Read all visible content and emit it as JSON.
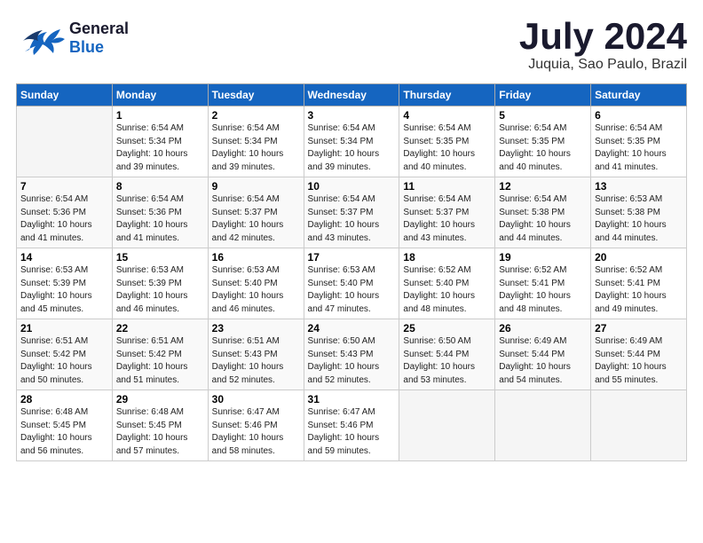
{
  "header": {
    "logo": {
      "line1": "General",
      "line2": "Blue"
    },
    "title": "July 2024",
    "location": "Juquia, Sao Paulo, Brazil"
  },
  "weekdays": [
    "Sunday",
    "Monday",
    "Tuesday",
    "Wednesday",
    "Thursday",
    "Friday",
    "Saturday"
  ],
  "weeks": [
    [
      {
        "day": "",
        "info": ""
      },
      {
        "day": "1",
        "info": "Sunrise: 6:54 AM\nSunset: 5:34 PM\nDaylight: 10 hours\nand 39 minutes."
      },
      {
        "day": "2",
        "info": "Sunrise: 6:54 AM\nSunset: 5:34 PM\nDaylight: 10 hours\nand 39 minutes."
      },
      {
        "day": "3",
        "info": "Sunrise: 6:54 AM\nSunset: 5:34 PM\nDaylight: 10 hours\nand 39 minutes."
      },
      {
        "day": "4",
        "info": "Sunrise: 6:54 AM\nSunset: 5:35 PM\nDaylight: 10 hours\nand 40 minutes."
      },
      {
        "day": "5",
        "info": "Sunrise: 6:54 AM\nSunset: 5:35 PM\nDaylight: 10 hours\nand 40 minutes."
      },
      {
        "day": "6",
        "info": "Sunrise: 6:54 AM\nSunset: 5:35 PM\nDaylight: 10 hours\nand 41 minutes."
      }
    ],
    [
      {
        "day": "7",
        "info": "Sunrise: 6:54 AM\nSunset: 5:36 PM\nDaylight: 10 hours\nand 41 minutes."
      },
      {
        "day": "8",
        "info": "Sunrise: 6:54 AM\nSunset: 5:36 PM\nDaylight: 10 hours\nand 41 minutes."
      },
      {
        "day": "9",
        "info": "Sunrise: 6:54 AM\nSunset: 5:37 PM\nDaylight: 10 hours\nand 42 minutes."
      },
      {
        "day": "10",
        "info": "Sunrise: 6:54 AM\nSunset: 5:37 PM\nDaylight: 10 hours\nand 43 minutes."
      },
      {
        "day": "11",
        "info": "Sunrise: 6:54 AM\nSunset: 5:37 PM\nDaylight: 10 hours\nand 43 minutes."
      },
      {
        "day": "12",
        "info": "Sunrise: 6:54 AM\nSunset: 5:38 PM\nDaylight: 10 hours\nand 44 minutes."
      },
      {
        "day": "13",
        "info": "Sunrise: 6:53 AM\nSunset: 5:38 PM\nDaylight: 10 hours\nand 44 minutes."
      }
    ],
    [
      {
        "day": "14",
        "info": "Sunrise: 6:53 AM\nSunset: 5:39 PM\nDaylight: 10 hours\nand 45 minutes."
      },
      {
        "day": "15",
        "info": "Sunrise: 6:53 AM\nSunset: 5:39 PM\nDaylight: 10 hours\nand 46 minutes."
      },
      {
        "day": "16",
        "info": "Sunrise: 6:53 AM\nSunset: 5:40 PM\nDaylight: 10 hours\nand 46 minutes."
      },
      {
        "day": "17",
        "info": "Sunrise: 6:53 AM\nSunset: 5:40 PM\nDaylight: 10 hours\nand 47 minutes."
      },
      {
        "day": "18",
        "info": "Sunrise: 6:52 AM\nSunset: 5:40 PM\nDaylight: 10 hours\nand 48 minutes."
      },
      {
        "day": "19",
        "info": "Sunrise: 6:52 AM\nSunset: 5:41 PM\nDaylight: 10 hours\nand 48 minutes."
      },
      {
        "day": "20",
        "info": "Sunrise: 6:52 AM\nSunset: 5:41 PM\nDaylight: 10 hours\nand 49 minutes."
      }
    ],
    [
      {
        "day": "21",
        "info": "Sunrise: 6:51 AM\nSunset: 5:42 PM\nDaylight: 10 hours\nand 50 minutes."
      },
      {
        "day": "22",
        "info": "Sunrise: 6:51 AM\nSunset: 5:42 PM\nDaylight: 10 hours\nand 51 minutes."
      },
      {
        "day": "23",
        "info": "Sunrise: 6:51 AM\nSunset: 5:43 PM\nDaylight: 10 hours\nand 52 minutes."
      },
      {
        "day": "24",
        "info": "Sunrise: 6:50 AM\nSunset: 5:43 PM\nDaylight: 10 hours\nand 52 minutes."
      },
      {
        "day": "25",
        "info": "Sunrise: 6:50 AM\nSunset: 5:44 PM\nDaylight: 10 hours\nand 53 minutes."
      },
      {
        "day": "26",
        "info": "Sunrise: 6:49 AM\nSunset: 5:44 PM\nDaylight: 10 hours\nand 54 minutes."
      },
      {
        "day": "27",
        "info": "Sunrise: 6:49 AM\nSunset: 5:44 PM\nDaylight: 10 hours\nand 55 minutes."
      }
    ],
    [
      {
        "day": "28",
        "info": "Sunrise: 6:48 AM\nSunset: 5:45 PM\nDaylight: 10 hours\nand 56 minutes."
      },
      {
        "day": "29",
        "info": "Sunrise: 6:48 AM\nSunset: 5:45 PM\nDaylight: 10 hours\nand 57 minutes."
      },
      {
        "day": "30",
        "info": "Sunrise: 6:47 AM\nSunset: 5:46 PM\nDaylight: 10 hours\nand 58 minutes."
      },
      {
        "day": "31",
        "info": "Sunrise: 6:47 AM\nSunset: 5:46 PM\nDaylight: 10 hours\nand 59 minutes."
      },
      {
        "day": "",
        "info": ""
      },
      {
        "day": "",
        "info": ""
      },
      {
        "day": "",
        "info": ""
      }
    ]
  ]
}
